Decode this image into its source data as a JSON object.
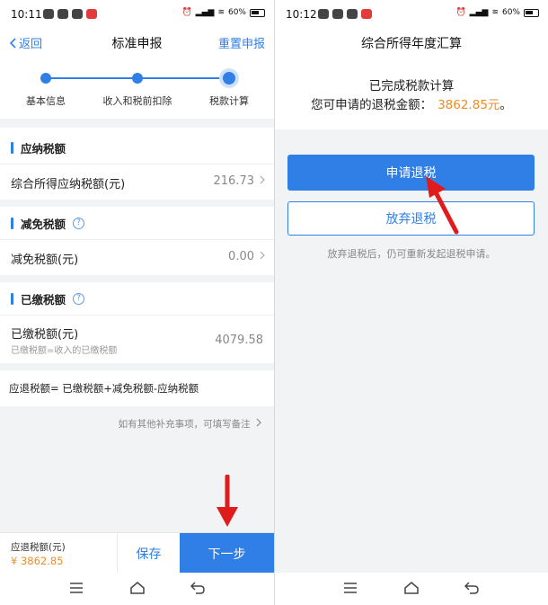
{
  "left": {
    "status": {
      "time": "10:11",
      "battery": "60%"
    },
    "nav": {
      "back": "返回",
      "title": "标准申报",
      "action": "重置申报"
    },
    "steps": [
      "基本信息",
      "收入和税前扣除",
      "税款计算"
    ],
    "sections": {
      "payable": {
        "title": "应纳税额",
        "row_label": "综合所得应纳税额(元)",
        "row_value": "216.73"
      },
      "reduction": {
        "title": "减免税额",
        "row_label": "减免税额(元)",
        "row_value": "0.00"
      },
      "paid": {
        "title": "已缴税额",
        "row_label": "已缴税额(元)",
        "row_sub": "已缴税额=收入的已缴税额",
        "row_value": "4079.58"
      }
    },
    "formula": "应退税额= 已缴税额+减免税额-应纳税额",
    "note": "如有其他补充事项，可填写备注",
    "footer": {
      "label": "应退税额(元)",
      "amount": "¥ 3862.85",
      "save": "保存",
      "next": "下一步"
    }
  },
  "right": {
    "status": {
      "time": "10:12",
      "battery": "60%"
    },
    "nav": {
      "title": "综合所得年度汇算"
    },
    "done_title": "已完成税款计算",
    "refund_prefix": "您可申请的退税金额：",
    "refund_amount": "3862.85元",
    "refund_suffix": "。",
    "apply_button": "申请退税",
    "abandon_button": "放弃退税",
    "hint": "放弃退税后，仍可重新发起退税申请。"
  },
  "colors": {
    "accent": "#2f7fe6",
    "amount": "#f08b22",
    "annotation_arrow": "#e01b1b"
  }
}
